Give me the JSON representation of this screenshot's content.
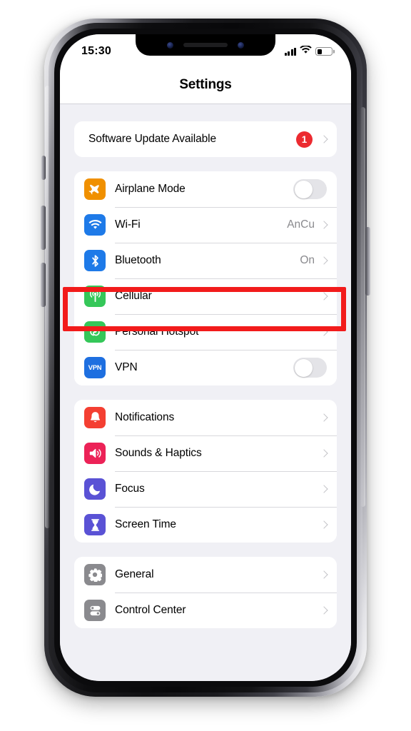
{
  "status_bar": {
    "time": "15:30",
    "signal_icon": "cellular-signal-icon",
    "wifi_icon": "wifi-icon",
    "battery_icon": "battery-icon",
    "battery_level_pct": 34
  },
  "navbar": {
    "title": "Settings"
  },
  "groups": [
    {
      "id": "update-group",
      "rows": [
        {
          "name": "software-update",
          "label": "Software Update Available",
          "icon": null,
          "accessory": "chevron",
          "badge": "1",
          "badge_color": "#ec2a30"
        }
      ]
    },
    {
      "id": "connectivity-group",
      "rows": [
        {
          "name": "airplane-mode",
          "label": "Airplane Mode",
          "icon": "airplane-icon",
          "icon_color": "#f09000",
          "accessory": "toggle",
          "toggle_on": false
        },
        {
          "name": "wifi",
          "label": "Wi-Fi",
          "icon": "wifi-icon",
          "icon_color": "#1e7ae8",
          "accessory": "chevron",
          "value": "AnCu"
        },
        {
          "name": "bluetooth",
          "label": "Bluetooth",
          "icon": "bluetooth-icon",
          "icon_color": "#1e7ae8",
          "accessory": "chevron",
          "value": "On"
        },
        {
          "name": "cellular",
          "label": "Cellular",
          "icon": "cellular-antenna-icon",
          "icon_color": "#35c759",
          "accessory": "chevron",
          "value": "",
          "highlighted": true
        },
        {
          "name": "personal-hotspot",
          "label": "Personal Hotspot",
          "icon": "hotspot-link-icon",
          "icon_color": "#35c759",
          "accessory": "chevron",
          "value": ""
        },
        {
          "name": "vpn",
          "label": "VPN",
          "icon": "vpn-icon",
          "icon_color": "#1e6fe0",
          "icon_text": "VPN",
          "accessory": "toggle",
          "toggle_on": false
        }
      ]
    },
    {
      "id": "notifications-group",
      "rows": [
        {
          "name": "notifications",
          "label": "Notifications",
          "icon": "bell-icon",
          "icon_color": "#f43f32",
          "accessory": "chevron"
        },
        {
          "name": "sounds-haptics",
          "label": "Sounds & Haptics",
          "icon": "speaker-icon",
          "icon_color": "#ec2257",
          "accessory": "chevron"
        },
        {
          "name": "focus",
          "label": "Focus",
          "icon": "moon-icon",
          "icon_color": "#5a52d5",
          "accessory": "chevron"
        },
        {
          "name": "screen-time",
          "label": "Screen Time",
          "icon": "hourglass-icon",
          "icon_color": "#5a52d5",
          "accessory": "chevron"
        }
      ]
    },
    {
      "id": "system-group",
      "rows": [
        {
          "name": "general",
          "label": "General",
          "icon": "gear-icon",
          "icon_color": "#8a8a8e",
          "accessory": "chevron"
        },
        {
          "name": "control-center",
          "label": "Control Center",
          "icon": "sliders-icon",
          "icon_color": "#8a8a8e",
          "accessory": "chevron"
        }
      ]
    }
  ],
  "annotation": {
    "name": "cellular-highlight-box",
    "color": "#f21b1b",
    "target": "Cellular"
  }
}
